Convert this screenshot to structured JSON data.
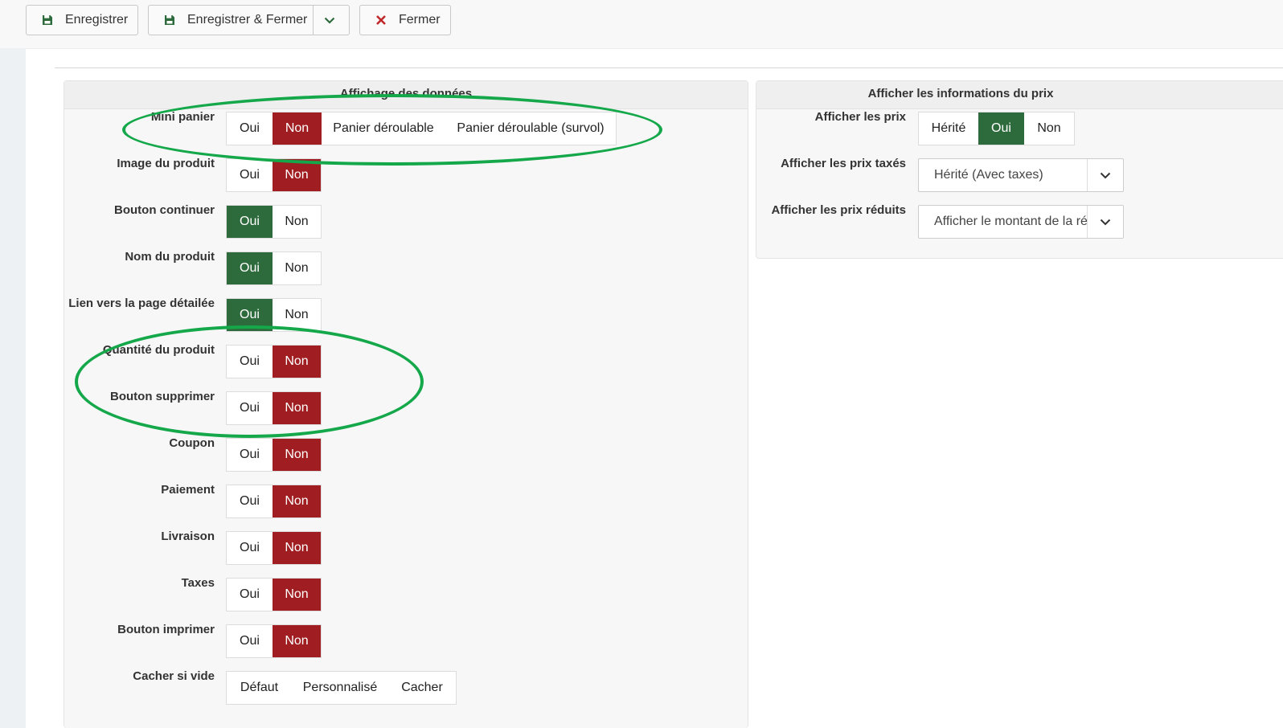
{
  "toolbar": {
    "save_label": "Enregistrer",
    "save_close_label": "Enregistrer & Fermer",
    "close_label": "Fermer"
  },
  "left_panel": {
    "title": "Affichage des données",
    "fields": [
      {
        "label": "Mini panier",
        "options": [
          "Oui",
          "Non",
          "Panier déroulable",
          "Panier déroulable (survol)"
        ],
        "selected": "Non"
      },
      {
        "label": "Image du produit",
        "options": [
          "Oui",
          "Non"
        ],
        "selected": "Non"
      },
      {
        "label": "Bouton continuer",
        "options": [
          "Oui",
          "Non"
        ],
        "selected": "Oui"
      },
      {
        "label": "Nom du produit",
        "options": [
          "Oui",
          "Non"
        ],
        "selected": "Oui"
      },
      {
        "label": "Lien vers la page détailée",
        "options": [
          "Oui",
          "Non"
        ],
        "selected": "Oui"
      },
      {
        "label": "Quantité du produit",
        "options": [
          "Oui",
          "Non"
        ],
        "selected": "Non"
      },
      {
        "label": "Bouton supprimer",
        "options": [
          "Oui",
          "Non"
        ],
        "selected": "Non"
      },
      {
        "label": "Coupon",
        "options": [
          "Oui",
          "Non"
        ],
        "selected": "Non"
      },
      {
        "label": "Paiement",
        "options": [
          "Oui",
          "Non"
        ],
        "selected": "Non"
      },
      {
        "label": "Livraison",
        "options": [
          "Oui",
          "Non"
        ],
        "selected": "Non"
      },
      {
        "label": "Taxes",
        "options": [
          "Oui",
          "Non"
        ],
        "selected": "Non"
      },
      {
        "label": "Bouton imprimer",
        "options": [
          "Oui",
          "Non"
        ],
        "selected": "Non"
      },
      {
        "label": "Cacher si vide",
        "options": [
          "Défaut",
          "Personnalisé",
          "Cacher"
        ],
        "selected": ""
      }
    ]
  },
  "right_panel": {
    "title": "Afficher les informations du prix",
    "show_price": {
      "label": "Afficher les prix",
      "options": [
        "Hérité",
        "Oui",
        "Non"
      ],
      "selected": "Oui"
    },
    "taxed_price": {
      "label": "Afficher les prix taxés",
      "value": "Hérité (Avec taxes)"
    },
    "reduced_price": {
      "label": "Afficher les prix réduits",
      "value": "Afficher le montant de la ré"
    }
  },
  "colors": {
    "no_selected": "#a01e21",
    "yes_selected": "#2e6b3c",
    "annotation": "#14a84a"
  }
}
